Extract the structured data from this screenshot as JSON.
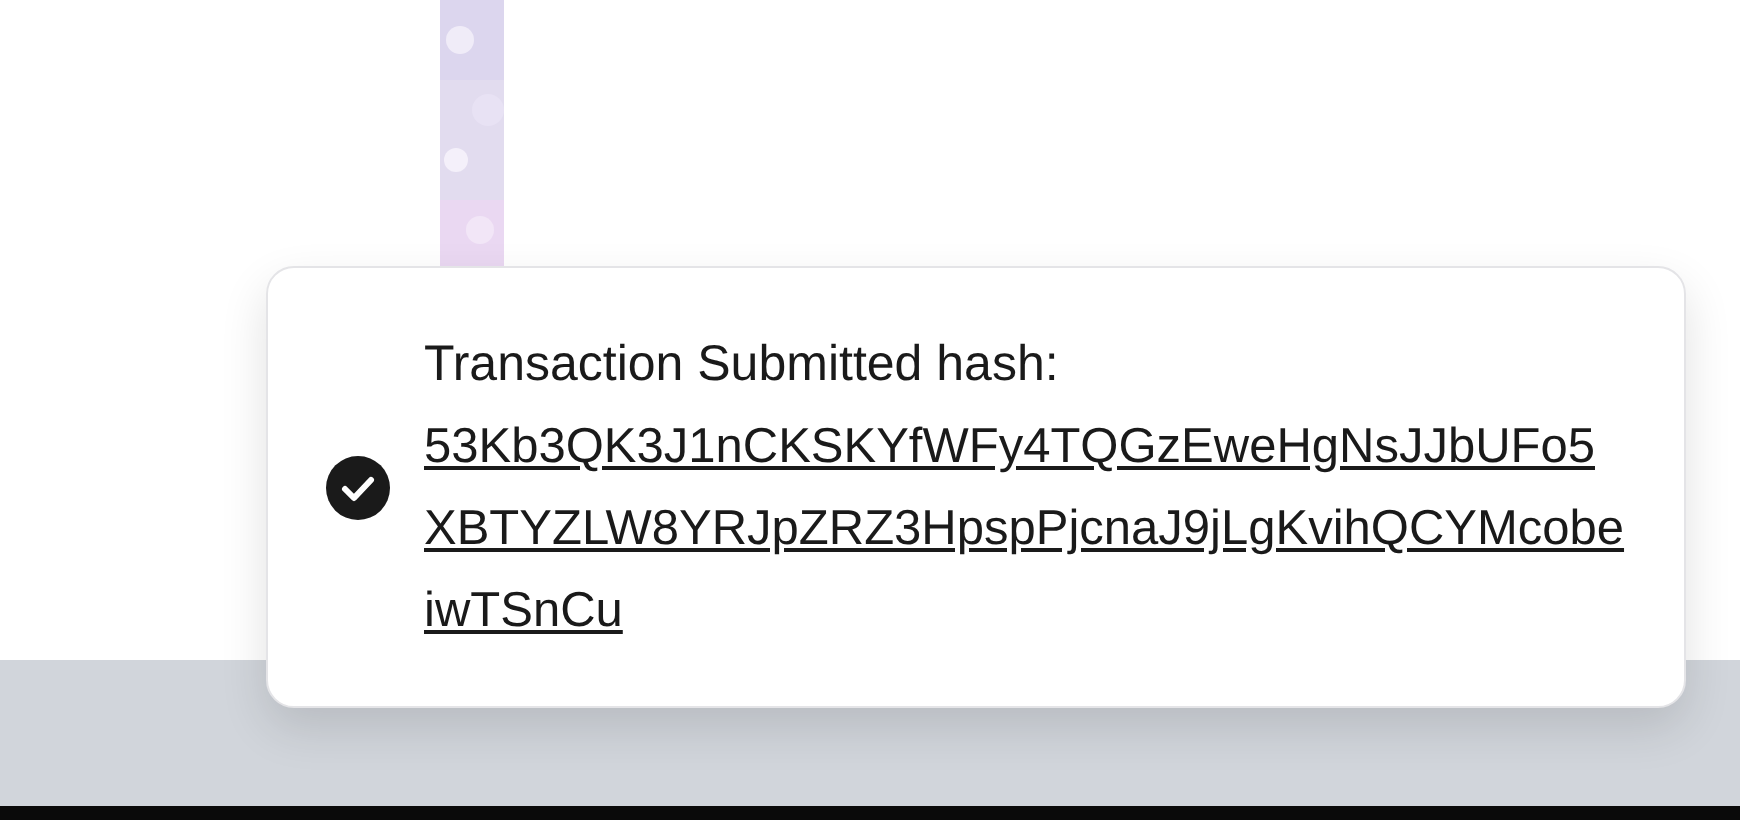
{
  "toast": {
    "kind": "success",
    "title": "Transaction Submitted hash:",
    "hash": "53Kb3QK3J1nCKSKYfWFy4TQGzEweHgNsJJbUFo5XBTYZLW8YRJpZRZ3HpspPjcnaJ9jLgKvihQCYMcobeiwTSnCu"
  }
}
